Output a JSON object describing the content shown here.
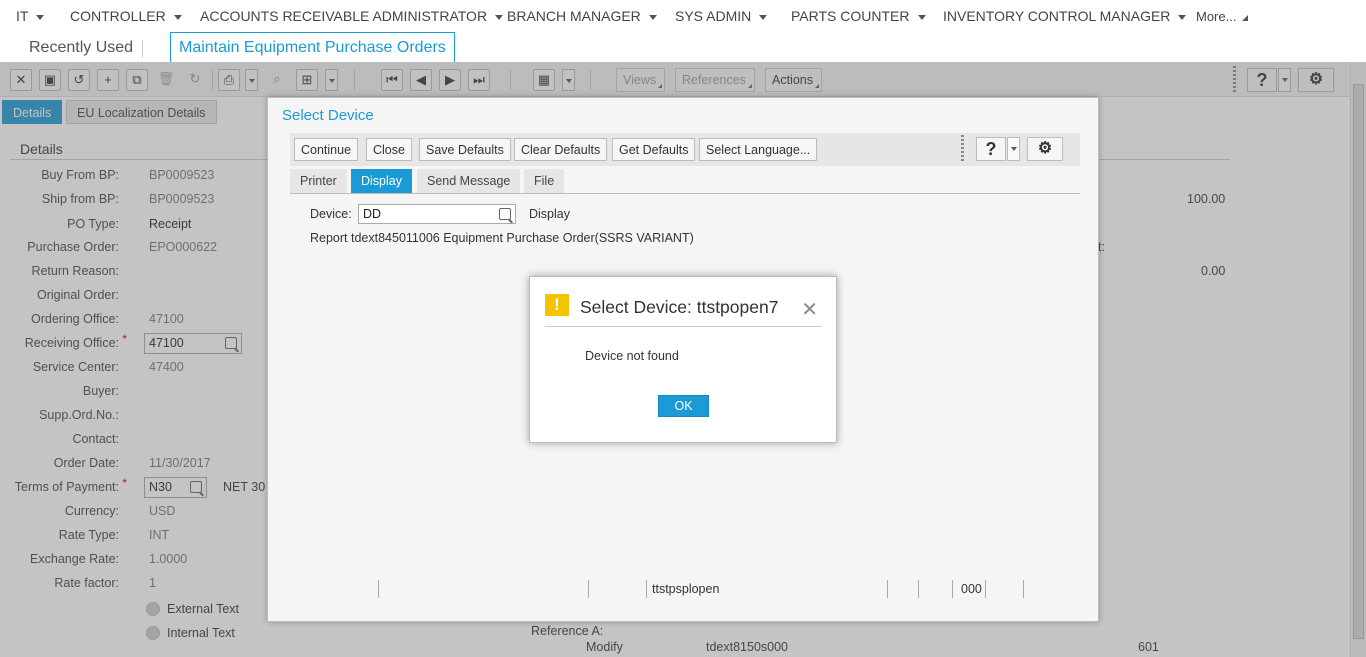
{
  "roles": [
    "IT",
    "CONTROLLER",
    "ACCOUNTS RECEIVABLE ADMINISTRATOR",
    "BRANCH MANAGER",
    "SYS ADMIN",
    "PARTS COUNTER",
    "INVENTORY CONTROL MANAGER"
  ],
  "roles_more": "More...",
  "tabs": {
    "recent": "Recently Used",
    "active": "Maintain Equipment Purchase Orders"
  },
  "toolbar": {
    "views": "Views",
    "references": "References",
    "actions": "Actions",
    "help": "?"
  },
  "subtabs": [
    "Details",
    "EU Localization Details"
  ],
  "section_title": "Details",
  "fields": [
    {
      "label": "Buy From BP:",
      "value": "BP0009523"
    },
    {
      "label": "Ship from BP:",
      "value": "BP0009523"
    },
    {
      "label": "PO Type:",
      "value": "Receipt"
    },
    {
      "label": "Purchase Order:",
      "value": "EPO000622"
    },
    {
      "label": "Return Reason:",
      "value": ""
    },
    {
      "label": "Original Order:",
      "value": ""
    },
    {
      "label": "Ordering Office:",
      "value": "47100"
    },
    {
      "label": "Receiving Office:",
      "value": "47100"
    },
    {
      "label": "Service Center:",
      "value": "47400"
    },
    {
      "label": "Buyer:",
      "value": ""
    },
    {
      "label": "Supp.Ord.No.:",
      "value": ""
    },
    {
      "label": "Contact:",
      "value": ""
    },
    {
      "label": "Order Date:",
      "value": "11/30/2017"
    },
    {
      "label": "Terms of Payment:",
      "value": "N30"
    },
    {
      "label": "Currency:",
      "value": "USD"
    },
    {
      "label": "Rate Type:",
      "value": "INT"
    },
    {
      "label": "Exchange Rate:",
      "value": "1.0000"
    },
    {
      "label": "Rate factor:",
      "value": "1"
    }
  ],
  "terms_desc": "NET 30",
  "right_values": {
    "amount1": "100.00",
    "amount2": "0.00",
    "partial": "t:"
  },
  "external_text": "External Text",
  "internal_text": "Internal Text",
  "reference_a": "Reference A:",
  "bottom_row": {
    "modify": "Modify",
    "session": "tdext8150s000",
    "num": "601"
  },
  "dialog": {
    "title": "Select Device",
    "buttons": [
      "Continue",
      "Close",
      "Save Defaults",
      "Clear Defaults",
      "Get Defaults",
      "Select Language..."
    ],
    "help": "?",
    "tabs": [
      "Printer",
      "Display",
      "Send Message",
      "File"
    ],
    "device_label": "Device:",
    "device_value": "DD",
    "device_desc": "Display",
    "report": "Report tdext845011006 Equipment Purchase Order(SSRS VARIANT)",
    "grid": {
      "device_name": "ttstpsplopen",
      "code": "000"
    }
  },
  "alert": {
    "title": "Select Device: ttstpopen7",
    "close": "✕",
    "message": "Device not found",
    "ok": "OK"
  },
  "colors": {
    "accent": "#1c9ad6",
    "warning": "#f5c400"
  }
}
